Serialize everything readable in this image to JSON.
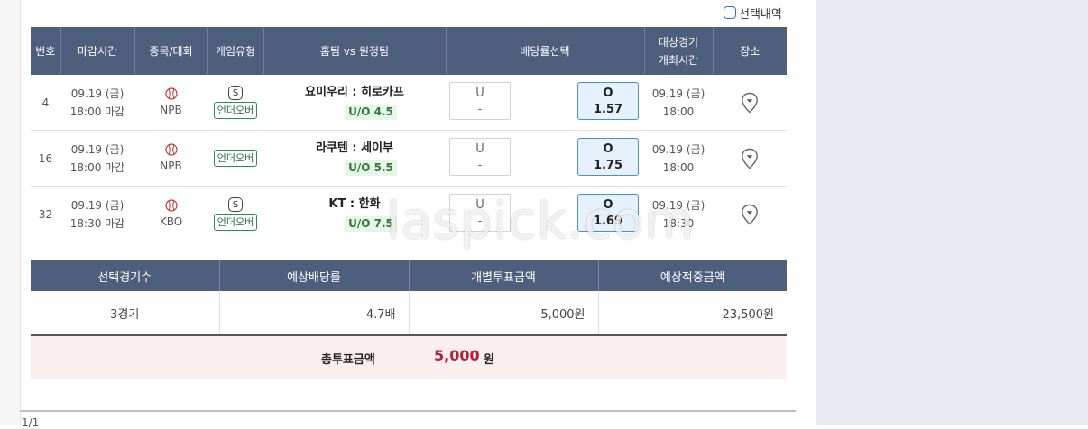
{
  "select_toggle": {
    "label": "선택내역"
  },
  "columns": {
    "number": "번호",
    "deadline": "마감시간",
    "sport": "종목/대회",
    "game_type": "게임유형",
    "matchup": "홈팀 vs 원정팀",
    "odds": "배당률선택",
    "game_time_1": "대상경기",
    "game_time_2": "개최시간",
    "venue": "장소"
  },
  "games": [
    {
      "number": "4",
      "deadline_date": "09.19 (금)",
      "deadline_time": "18:00 마감",
      "sport_icon": "baseball-icon",
      "league": "NPB",
      "has_special": true,
      "special_badge": "S",
      "type_label": "언더오버",
      "home": "요미우리",
      "sep": ":",
      "away": "히로카프",
      "line": "U/O 4.5",
      "under_label": "U",
      "under_value": "-",
      "over_label": "O",
      "over_value": "1.57",
      "game_date": "09.19 (금)",
      "game_time": "18:00",
      "venue_icon": "map-pin-icon"
    },
    {
      "number": "16",
      "deadline_date": "09.19 (금)",
      "deadline_time": "18:00 마감",
      "sport_icon": "baseball-icon",
      "league": "NPB",
      "has_special": false,
      "special_badge": "",
      "type_label": "언더오버",
      "home": "라쿠텐",
      "sep": ":",
      "away": "세이부",
      "line": "U/O 5.5",
      "under_label": "U",
      "under_value": "-",
      "over_label": "O",
      "over_value": "1.75",
      "game_date": "09.19 (금)",
      "game_time": "18:00",
      "venue_icon": "map-pin-icon"
    },
    {
      "number": "32",
      "deadline_date": "09.19 (금)",
      "deadline_time": "18:30 마감",
      "sport_icon": "baseball-icon",
      "league": "KBO",
      "has_special": true,
      "special_badge": "S",
      "type_label": "언더오버",
      "home": "KT",
      "sep": ":",
      "away": "한화",
      "line": "U/O 7.5",
      "under_label": "U",
      "under_value": "-",
      "over_label": "O",
      "over_value": "1.69",
      "game_date": "09.19 (금)",
      "game_time": "18:30",
      "venue_icon": "map-pin-icon"
    }
  ],
  "summary": {
    "headers": [
      "선택경기수",
      "예상배당률",
      "개별투표금액",
      "예상적중금액"
    ],
    "values": [
      "3경기",
      "4.7배",
      "5,000원",
      "23,500원"
    ]
  },
  "total": {
    "label": "총투표금액",
    "value": "5,000",
    "unit": "원"
  },
  "watermark": "laspick.com",
  "bottom_text": "1/1",
  "colors": {
    "header_bg": "#4e5f7e",
    "selected_odds_border": "#4a8ed8",
    "total_value": "#b0213b",
    "line_tag": "#2e7d32"
  }
}
